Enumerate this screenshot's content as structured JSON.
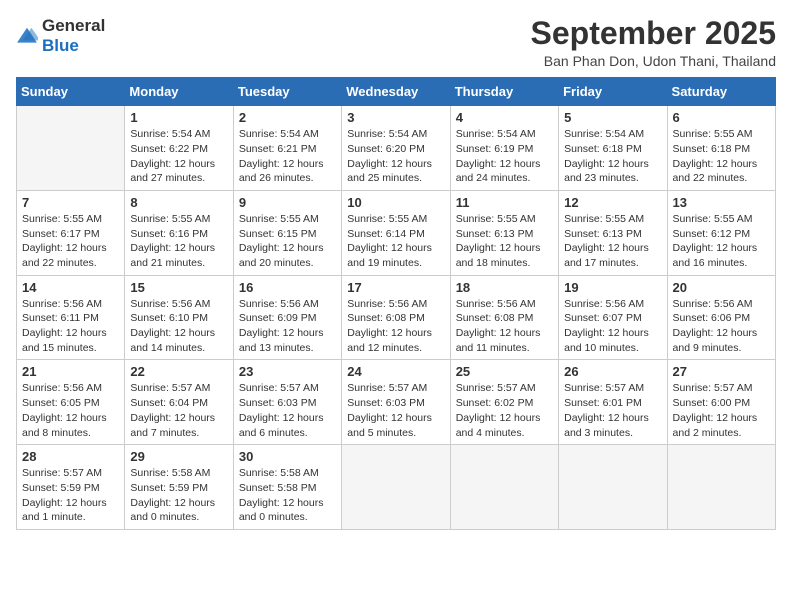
{
  "header": {
    "logo_general": "General",
    "logo_blue": "Blue",
    "month_title": "September 2025",
    "location": "Ban Phan Don, Udon Thani, Thailand"
  },
  "days_of_week": [
    "Sunday",
    "Monday",
    "Tuesday",
    "Wednesday",
    "Thursday",
    "Friday",
    "Saturday"
  ],
  "weeks": [
    [
      {
        "day": "",
        "info": ""
      },
      {
        "day": "1",
        "info": "Sunrise: 5:54 AM\nSunset: 6:22 PM\nDaylight: 12 hours\nand 27 minutes."
      },
      {
        "day": "2",
        "info": "Sunrise: 5:54 AM\nSunset: 6:21 PM\nDaylight: 12 hours\nand 26 minutes."
      },
      {
        "day": "3",
        "info": "Sunrise: 5:54 AM\nSunset: 6:20 PM\nDaylight: 12 hours\nand 25 minutes."
      },
      {
        "day": "4",
        "info": "Sunrise: 5:54 AM\nSunset: 6:19 PM\nDaylight: 12 hours\nand 24 minutes."
      },
      {
        "day": "5",
        "info": "Sunrise: 5:54 AM\nSunset: 6:18 PM\nDaylight: 12 hours\nand 23 minutes."
      },
      {
        "day": "6",
        "info": "Sunrise: 5:55 AM\nSunset: 6:18 PM\nDaylight: 12 hours\nand 22 minutes."
      }
    ],
    [
      {
        "day": "7",
        "info": "Sunrise: 5:55 AM\nSunset: 6:17 PM\nDaylight: 12 hours\nand 22 minutes."
      },
      {
        "day": "8",
        "info": "Sunrise: 5:55 AM\nSunset: 6:16 PM\nDaylight: 12 hours\nand 21 minutes."
      },
      {
        "day": "9",
        "info": "Sunrise: 5:55 AM\nSunset: 6:15 PM\nDaylight: 12 hours\nand 20 minutes."
      },
      {
        "day": "10",
        "info": "Sunrise: 5:55 AM\nSunset: 6:14 PM\nDaylight: 12 hours\nand 19 minutes."
      },
      {
        "day": "11",
        "info": "Sunrise: 5:55 AM\nSunset: 6:13 PM\nDaylight: 12 hours\nand 18 minutes."
      },
      {
        "day": "12",
        "info": "Sunrise: 5:55 AM\nSunset: 6:13 PM\nDaylight: 12 hours\nand 17 minutes."
      },
      {
        "day": "13",
        "info": "Sunrise: 5:55 AM\nSunset: 6:12 PM\nDaylight: 12 hours\nand 16 minutes."
      }
    ],
    [
      {
        "day": "14",
        "info": "Sunrise: 5:56 AM\nSunset: 6:11 PM\nDaylight: 12 hours\nand 15 minutes."
      },
      {
        "day": "15",
        "info": "Sunrise: 5:56 AM\nSunset: 6:10 PM\nDaylight: 12 hours\nand 14 minutes."
      },
      {
        "day": "16",
        "info": "Sunrise: 5:56 AM\nSunset: 6:09 PM\nDaylight: 12 hours\nand 13 minutes."
      },
      {
        "day": "17",
        "info": "Sunrise: 5:56 AM\nSunset: 6:08 PM\nDaylight: 12 hours\nand 12 minutes."
      },
      {
        "day": "18",
        "info": "Sunrise: 5:56 AM\nSunset: 6:08 PM\nDaylight: 12 hours\nand 11 minutes."
      },
      {
        "day": "19",
        "info": "Sunrise: 5:56 AM\nSunset: 6:07 PM\nDaylight: 12 hours\nand 10 minutes."
      },
      {
        "day": "20",
        "info": "Sunrise: 5:56 AM\nSunset: 6:06 PM\nDaylight: 12 hours\nand 9 minutes."
      }
    ],
    [
      {
        "day": "21",
        "info": "Sunrise: 5:56 AM\nSunset: 6:05 PM\nDaylight: 12 hours\nand 8 minutes."
      },
      {
        "day": "22",
        "info": "Sunrise: 5:57 AM\nSunset: 6:04 PM\nDaylight: 12 hours\nand 7 minutes."
      },
      {
        "day": "23",
        "info": "Sunrise: 5:57 AM\nSunset: 6:03 PM\nDaylight: 12 hours\nand 6 minutes."
      },
      {
        "day": "24",
        "info": "Sunrise: 5:57 AM\nSunset: 6:03 PM\nDaylight: 12 hours\nand 5 minutes."
      },
      {
        "day": "25",
        "info": "Sunrise: 5:57 AM\nSunset: 6:02 PM\nDaylight: 12 hours\nand 4 minutes."
      },
      {
        "day": "26",
        "info": "Sunrise: 5:57 AM\nSunset: 6:01 PM\nDaylight: 12 hours\nand 3 minutes."
      },
      {
        "day": "27",
        "info": "Sunrise: 5:57 AM\nSunset: 6:00 PM\nDaylight: 12 hours\nand 2 minutes."
      }
    ],
    [
      {
        "day": "28",
        "info": "Sunrise: 5:57 AM\nSunset: 5:59 PM\nDaylight: 12 hours\nand 1 minute."
      },
      {
        "day": "29",
        "info": "Sunrise: 5:58 AM\nSunset: 5:59 PM\nDaylight: 12 hours\nand 0 minutes."
      },
      {
        "day": "30",
        "info": "Sunrise: 5:58 AM\nSunset: 5:58 PM\nDaylight: 12 hours\nand 0 minutes."
      },
      {
        "day": "",
        "info": ""
      },
      {
        "day": "",
        "info": ""
      },
      {
        "day": "",
        "info": ""
      },
      {
        "day": "",
        "info": ""
      }
    ]
  ]
}
